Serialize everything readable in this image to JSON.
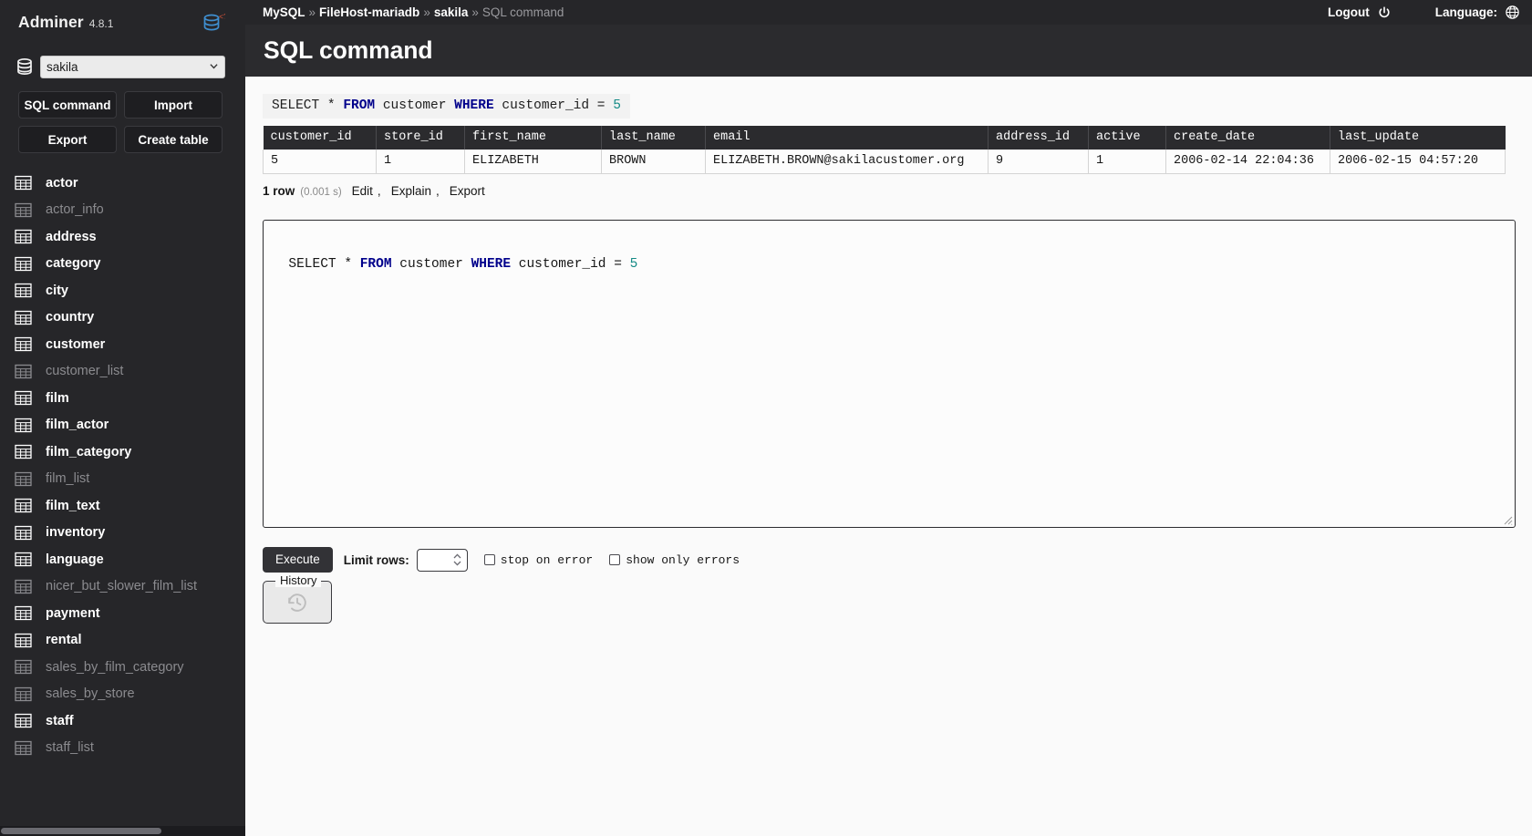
{
  "sidebar": {
    "brand": {
      "name": "Adminer",
      "version": "4.8.1",
      "logo_icon": "database-logo-icon"
    },
    "database_select": {
      "value": "sakila",
      "icon": "database-icon",
      "caret_icon": "chevron-down-icon"
    },
    "actions": [
      {
        "label": "SQL command",
        "name": "sql-command"
      },
      {
        "label": "Import",
        "name": "import"
      },
      {
        "label": "Export",
        "name": "export"
      },
      {
        "label": "Create table",
        "name": "create-table"
      }
    ],
    "tables": [
      {
        "label": "actor",
        "is_view": false
      },
      {
        "label": "actor_info",
        "is_view": true
      },
      {
        "label": "address",
        "is_view": false
      },
      {
        "label": "category",
        "is_view": false
      },
      {
        "label": "city",
        "is_view": false
      },
      {
        "label": "country",
        "is_view": false
      },
      {
        "label": "customer",
        "is_view": false
      },
      {
        "label": "customer_list",
        "is_view": true
      },
      {
        "label": "film",
        "is_view": false
      },
      {
        "label": "film_actor",
        "is_view": false
      },
      {
        "label": "film_category",
        "is_view": false
      },
      {
        "label": "film_list",
        "is_view": true
      },
      {
        "label": "film_text",
        "is_view": false
      },
      {
        "label": "inventory",
        "is_view": false
      },
      {
        "label": "language",
        "is_view": false
      },
      {
        "label": "nicer_but_slower_film_list",
        "is_view": true
      },
      {
        "label": "payment",
        "is_view": false
      },
      {
        "label": "rental",
        "is_view": false
      },
      {
        "label": "sales_by_film_category",
        "is_view": true
      },
      {
        "label": "sales_by_store",
        "is_view": true
      },
      {
        "label": "staff",
        "is_view": false
      },
      {
        "label": "staff_list",
        "is_view": true
      }
    ]
  },
  "header": {
    "breadcrumb": [
      {
        "label": "MySQL",
        "current": false
      },
      {
        "label": "FileHost-mariadb",
        "current": false
      },
      {
        "label": "sakila",
        "current": false
      },
      {
        "label": "SQL command",
        "current": true
      }
    ],
    "separator": "»",
    "logout_label": "Logout",
    "logout_icon": "power-icon",
    "language_label": "Language:",
    "language_icon": "globe-icon",
    "page_title": "SQL command"
  },
  "query_echo": {
    "tokens": [
      {
        "text": "SELECT * ",
        "type": "plain"
      },
      {
        "text": "FROM",
        "type": "keyword"
      },
      {
        "text": " customer ",
        "type": "plain"
      },
      {
        "text": "WHERE",
        "type": "keyword"
      },
      {
        "text": " customer_id = ",
        "type": "plain"
      },
      {
        "text": "5",
        "type": "number"
      }
    ]
  },
  "result": {
    "columns": [
      "customer_id",
      "store_id",
      "first_name",
      "last_name",
      "email",
      "address_id",
      "active",
      "create_date",
      "last_update"
    ],
    "rows": [
      [
        "5",
        "1",
        "ELIZABETH",
        "BROWN",
        "ELIZABETH.BROWN@sakilacustomer.org",
        "9",
        "1",
        "2006-02-14 22:04:36",
        "2006-02-15 04:57:20"
      ]
    ]
  },
  "status": {
    "row_count": "1 row",
    "time": "(0.001 s)",
    "actions": [
      "Edit",
      "Explain",
      "Export"
    ],
    "separator": ","
  },
  "editor": {
    "tokens": [
      {
        "text": "SELECT * ",
        "type": "plain"
      },
      {
        "text": "FROM",
        "type": "keyword"
      },
      {
        "text": " customer ",
        "type": "plain"
      },
      {
        "text": "WHERE",
        "type": "keyword"
      },
      {
        "text": " customer_id = ",
        "type": "plain"
      },
      {
        "text": "5",
        "type": "number"
      }
    ]
  },
  "controls": {
    "execute_label": "Execute",
    "limit_label": "Limit rows:",
    "limit_value": "",
    "checkboxes": [
      {
        "label": "stop on error",
        "checked": false
      },
      {
        "label": "show only errors",
        "checked": false
      }
    ]
  },
  "history": {
    "legend": "History",
    "icon": "history-clock-icon"
  },
  "colors": {
    "sidebar_bg": "#262629",
    "header_bg": "#262629",
    "main_bg": "#fafafa",
    "keyword": "#00008b",
    "number": "#168b86",
    "view_text": "#8b8b8f"
  }
}
